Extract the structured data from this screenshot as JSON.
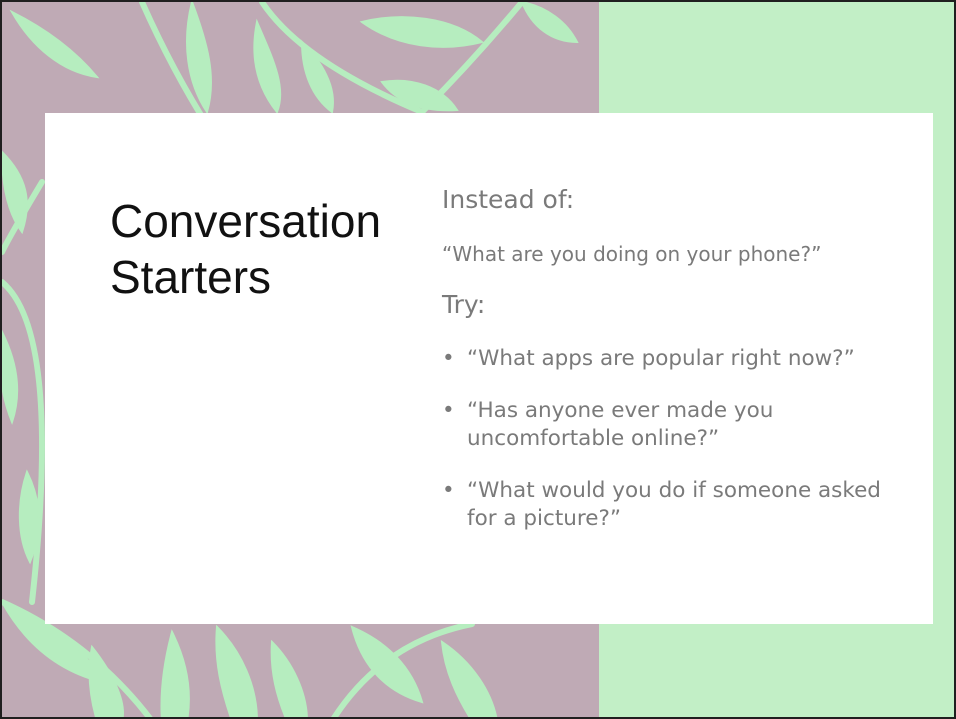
{
  "slide": {
    "title_line1": "Conversation",
    "title_line2": "Starters",
    "instead_label": "Instead of:",
    "instead_question": "“What are you doing on your phone?”",
    "try_label": "Try:",
    "bullet_glyph": "•",
    "items": [
      {
        "text": "“What apps are popular right now?”"
      },
      {
        "text": "“Has anyone ever made you uncomfortable online?”"
      },
      {
        "text": "“What would you do if someone asked for a picture?”"
      }
    ]
  },
  "colors": {
    "mauve_background": "#bfaab5",
    "mint_panel": "#c2efc6",
    "leaf_green": "#b6edbf",
    "body_text": "#7a7a7a",
    "title_text": "#111111"
  }
}
